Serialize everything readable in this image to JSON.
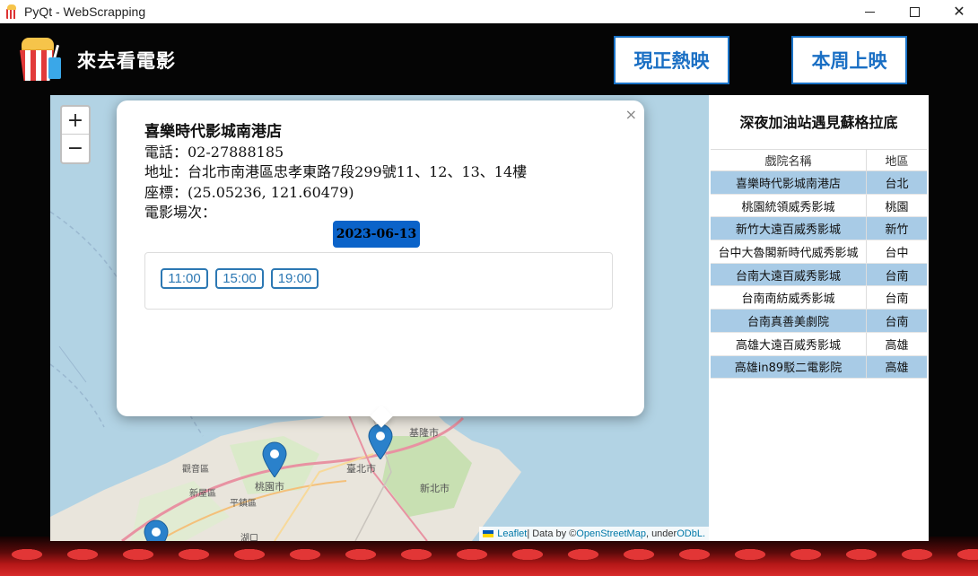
{
  "window": {
    "title": "PyQt - WebScrapping",
    "minimize": "—",
    "maximize": "☐",
    "close": "✕"
  },
  "header": {
    "brand": "來去看電影",
    "nav": [
      {
        "label": "現正熱映"
      },
      {
        "label": "本周上映"
      }
    ]
  },
  "map": {
    "zoom_in": "+",
    "zoom_out": "−",
    "labels": {
      "keelung": "基隆市",
      "taipei": "臺北市",
      "newtaipei": "新北市",
      "taoyuan": "桃園市",
      "guanyin": "觀音區",
      "xinwu": "新屋區",
      "pingzhen": "平鎮區",
      "hukou": "湖口"
    },
    "popup": {
      "close": "×",
      "cinema_name": "喜樂時代影城南港店",
      "phone": "電話：02-27888185",
      "address": "地址：台北市南港區忠孝東路7段299號11、12、13、14樓",
      "coords": "座標：(25.05236, 121.60479)",
      "showtimes_label": "電影場次：",
      "date": "2023-06-13",
      "times": [
        "11:00",
        "15:00",
        "19:00"
      ]
    },
    "attribution": {
      "leaflet": "Leaflet",
      "sep": " | Data by © ",
      "osm": "OpenStreetMap",
      "under": ", under ",
      "odbl": "ODbL."
    }
  },
  "panel": {
    "movie_title": "深夜加油站遇見蘇格拉底",
    "columns": [
      "戲院名稱",
      "地區"
    ],
    "rows": [
      {
        "name": "喜樂時代影城南港店",
        "region": "台北"
      },
      {
        "name": "桃園統領威秀影城",
        "region": "桃園"
      },
      {
        "name": "新竹大遠百威秀影城",
        "region": "新竹"
      },
      {
        "name": "台中大魯閣新時代威秀影城",
        "region": "台中"
      },
      {
        "name": "台南大遠百威秀影城",
        "region": "台南"
      },
      {
        "name": "台南南紡威秀影城",
        "region": "台南"
      },
      {
        "name": "台南真善美劇院",
        "region": "台南"
      },
      {
        "name": "高雄大遠百威秀影城",
        "region": "高雄"
      },
      {
        "name": "高雄in89駁二電影院",
        "region": "高雄"
      }
    ]
  },
  "colors": {
    "nav_border": "#1a73c8",
    "row_highlight": "#a8cbe6",
    "marker": "#2a81cb",
    "date_badge": "#0b63c9"
  }
}
